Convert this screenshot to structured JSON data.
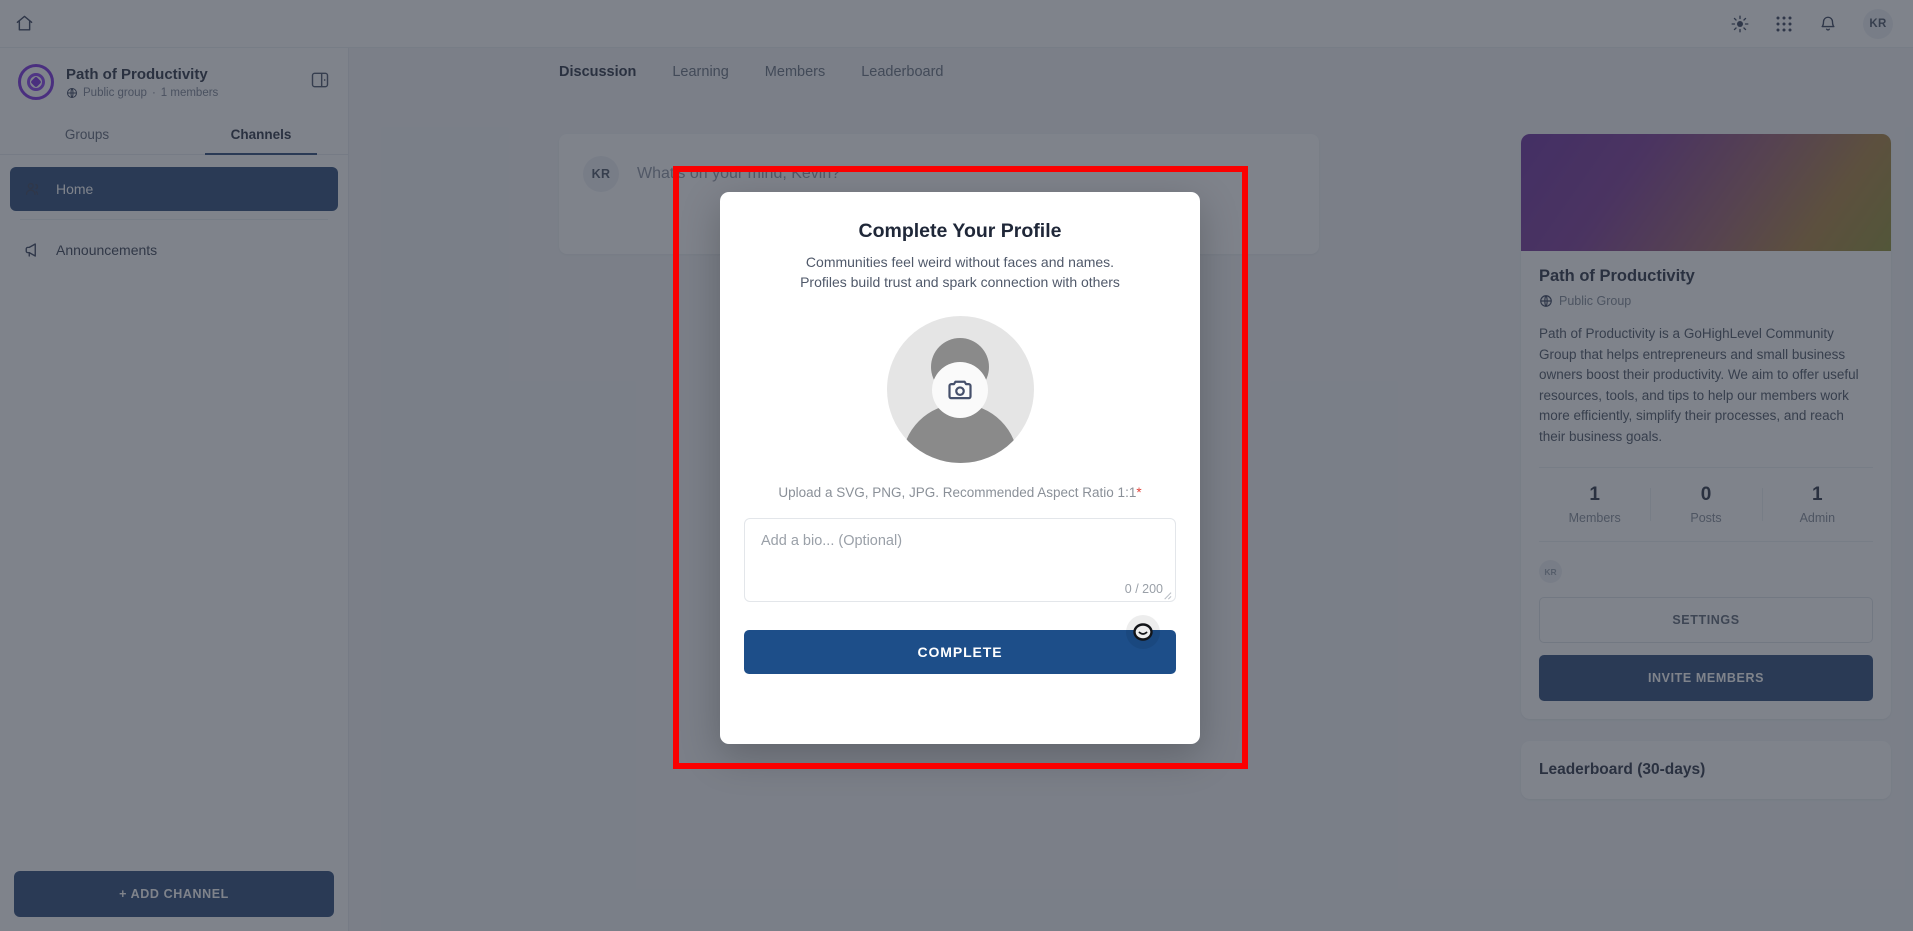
{
  "topbar": {
    "home_icon": "home-icon",
    "theme_icon": "sun-icon",
    "apps_icon": "grid-apps-icon",
    "notifications_icon": "bell-icon",
    "avatar_initials": "KR"
  },
  "sidebar": {
    "group_name": "Path of Productivity",
    "group_visibility": "Public group",
    "group_separator": "·",
    "group_members": "1 members",
    "panel_toggle_icon": "panel-toggle-icon",
    "tabs": [
      {
        "label": "Groups",
        "active": false
      },
      {
        "label": "Channels",
        "active": true
      }
    ],
    "channels": [
      {
        "label": "Home",
        "icon": "users-icon",
        "active": true
      },
      {
        "label": "Announcements",
        "icon": "megaphone-icon",
        "active": false
      }
    ],
    "add_channel_label": "+ ADD CHANNEL"
  },
  "main": {
    "tabs": [
      {
        "label": "Discussion",
        "active": true
      },
      {
        "label": "Learning",
        "active": false
      },
      {
        "label": "Members",
        "active": false
      },
      {
        "label": "Leaderboard",
        "active": false
      }
    ],
    "composer": {
      "avatar_initials": "KR",
      "placeholder": "What's on your mind, Kevin?"
    }
  },
  "rail": {
    "group_title": "Path of Productivity",
    "visibility": "Public Group",
    "description": "Path of Productivity is a GoHighLevel Community Group that helps entrepreneurs and small business owners boost their productivity. We aim to offer useful resources, tools, and tips to help our members work more efficiently, simplify their processes, and reach their business goals.",
    "stats": [
      {
        "value": "1",
        "label": "Members"
      },
      {
        "value": "0",
        "label": "Posts"
      },
      {
        "value": "1",
        "label": "Admin"
      }
    ],
    "member_avatars": [
      "KR"
    ],
    "settings_label": "SETTINGS",
    "invite_label": "INVITE MEMBERS",
    "leaderboard_title": "Leaderboard (30-days)"
  },
  "modal": {
    "title": "Complete Your Profile",
    "subtitle_line1": "Communities feel weird without faces and names.",
    "subtitle_line2": "Profiles build trust and spark connection with others",
    "avatar_icon": "camera-icon",
    "avatar_placeholder_icon": "person-placeholder-icon",
    "upload_hint": "Upload a SVG, PNG, JPG. Recommended Aspect Ratio 1:1",
    "upload_required_mark": "*",
    "bio_placeholder": "Add a bio... (Optional)",
    "bio_value": "",
    "bio_counter": "0 / 200",
    "complete_label": "COMPLETE"
  },
  "annotation": {
    "color": "#fb0000",
    "shape": "highlight-rectangle"
  }
}
